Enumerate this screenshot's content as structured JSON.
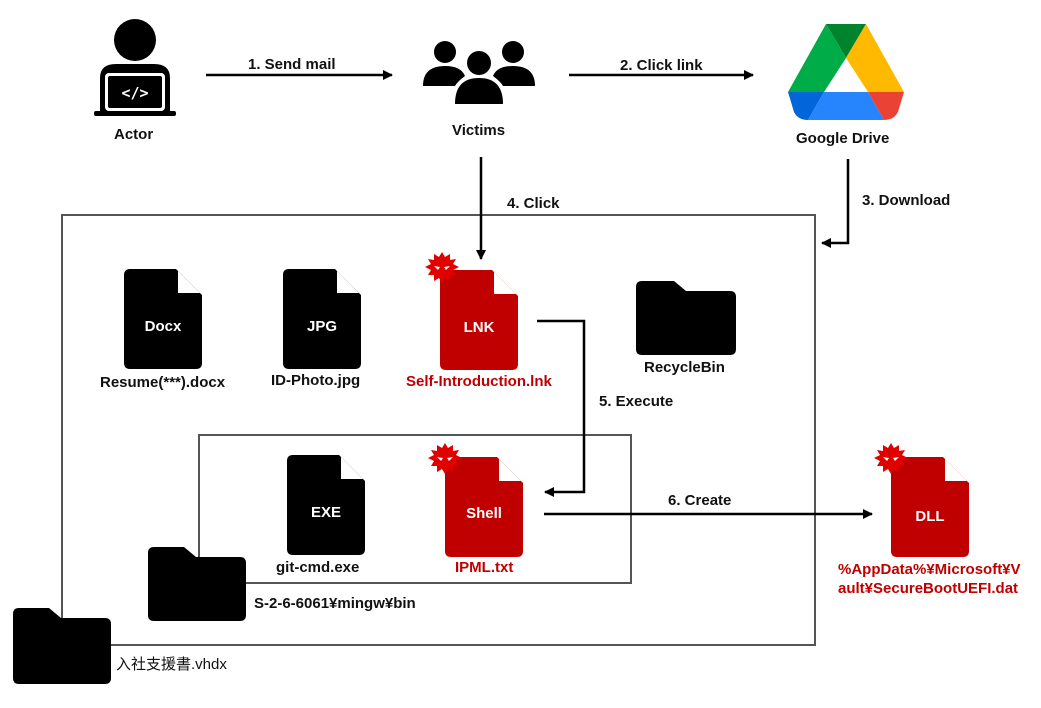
{
  "actors": {
    "actor": {
      "label": "Actor",
      "icon": "developer-laptop-icon"
    },
    "victims": {
      "label": "Victims",
      "icon": "group-users-icon"
    },
    "google_drive": {
      "label": "Google Drive",
      "icon": "google-drive-icon"
    }
  },
  "steps": [
    {
      "label": "1. Send mail"
    },
    {
      "label": "2. Click link"
    },
    {
      "label": "3. Download"
    },
    {
      "label": "4. Click"
    },
    {
      "label": "5. Execute"
    },
    {
      "label": "6. Create"
    }
  ],
  "containers": {
    "vhdx": {
      "label": "入社支援書.vhdx",
      "icon": "folder-icon"
    },
    "mingw": {
      "label": "S-2-6-6061¥mingw¥bin",
      "icon": "folder-icon"
    }
  },
  "files": [
    {
      "type": "Docx",
      "name": "Resume(***).docx",
      "malicious": false
    },
    {
      "type": "JPG",
      "name": "ID-Photo.jpg",
      "malicious": false
    },
    {
      "type": "LNK",
      "name": "Self-Introduction.lnk",
      "malicious": true
    },
    {
      "type": "EXE",
      "name": "git-cmd.exe",
      "malicious": false
    },
    {
      "type": "Shell",
      "name": "IPML.txt",
      "malicious": true
    },
    {
      "type": "DLL",
      "name_line1": "%AppData%¥Microsoft¥V",
      "name_line2": "ault¥SecureBootUEFI.dat",
      "malicious": true
    }
  ],
  "folders": [
    {
      "name": "RecycleBin"
    }
  ],
  "colors": {
    "malicious": "#c00000",
    "benign": "#000000",
    "box_border": "#555555",
    "drive_green": "#0f9d58",
    "drive_yellow": "#ffba00",
    "drive_blue": "#2684fc",
    "drive_red": "#ea4335"
  }
}
